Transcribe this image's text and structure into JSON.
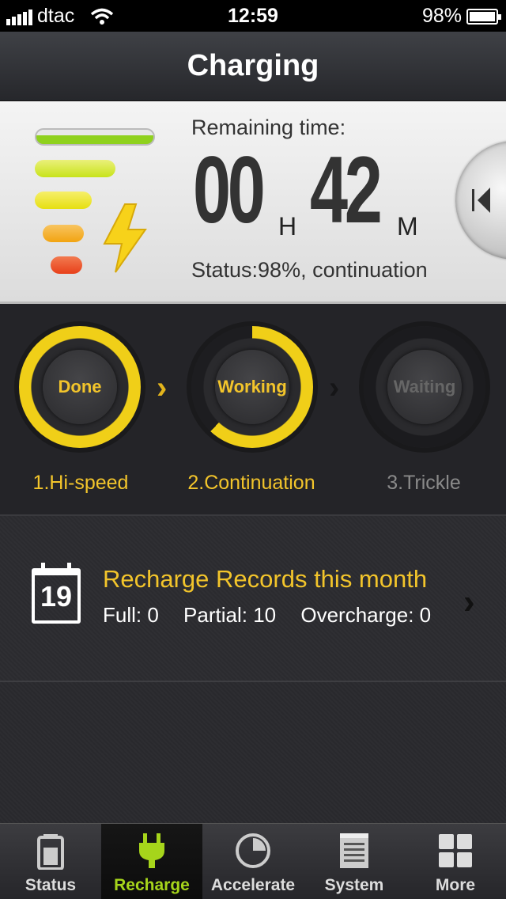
{
  "status_bar": {
    "carrier": "dtac",
    "time": "12:59",
    "battery": "98%"
  },
  "header": {
    "title": "Charging"
  },
  "charge_card": {
    "remaining_label": "Remaining time:",
    "hours": "00",
    "hours_unit": "H",
    "minutes": "42",
    "minutes_unit": "M",
    "status": "Status:98%, continuation",
    "level_bar_colors": [
      "#8fd11d",
      "#c8e31a",
      "#e6df12",
      "#f2a411",
      "#e8401a"
    ]
  },
  "stages": [
    {
      "ring_text": "Done",
      "label": "1.Hi-speed",
      "state": "done",
      "progress": 1.0
    },
    {
      "ring_text": "Working",
      "label": "2.Continuation",
      "state": "working",
      "progress": 0.62
    },
    {
      "ring_text": "Waiting",
      "label": "3.Trickle",
      "state": "waiting",
      "progress": 0
    }
  ],
  "records": {
    "calendar_day": "19",
    "title": "Recharge Records this month",
    "full": "Full: 0",
    "partial": "Partial: 10",
    "overcharge": "Overcharge: 0"
  },
  "tabs": [
    {
      "label": "Status",
      "icon": "battery-icon"
    },
    {
      "label": "Recharge",
      "icon": "plug-icon",
      "active": true
    },
    {
      "label": "Accelerate",
      "icon": "pie-icon"
    },
    {
      "label": "System",
      "icon": "notepad-icon"
    },
    {
      "label": "More",
      "icon": "grid-icon"
    }
  ],
  "colors": {
    "accent_yellow": "#f3c52b",
    "accent_green": "#a6d51b"
  }
}
